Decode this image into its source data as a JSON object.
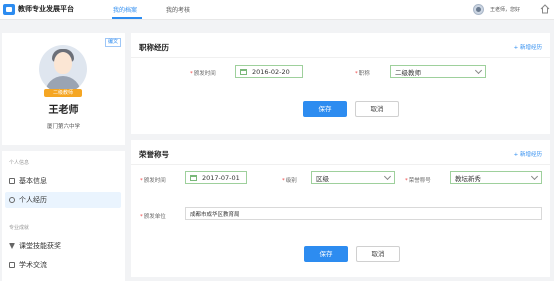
{
  "header": {
    "app_title": "教师专业发展平台",
    "tabs": [
      {
        "label": "我的档案",
        "active": true
      },
      {
        "label": "我的考核",
        "active": false
      }
    ],
    "user_greeting": "王老师，您好",
    "accent_color": "#2d8cf0"
  },
  "profile": {
    "edit_tag": "编文",
    "badge": "二级教师",
    "name": "王老师",
    "school": "厦门第六中学"
  },
  "menu": {
    "group_personal": "个人信息",
    "items_personal": [
      {
        "label": "基本信息",
        "icon": "document-icon",
        "active": false
      },
      {
        "label": "个人经历",
        "icon": "clock-icon",
        "active": true
      }
    ],
    "group_achievement": "专业成就",
    "items_achievement": [
      {
        "label": "课堂技能获奖",
        "icon": "trophy-icon",
        "active": false
      },
      {
        "label": "学术交流",
        "icon": "chat-icon",
        "active": false
      }
    ]
  },
  "title_card": {
    "title": "职称经历",
    "add_label": "+ 新增经历",
    "time_label": "颁发时间",
    "time_value": "2016-02-20",
    "title_label": "职称",
    "title_value": "二级教师",
    "save_label": "保存",
    "cancel_label": "取消"
  },
  "honor_card": {
    "title": "荣誉称号",
    "add_label": "+ 新增经历",
    "time_label": "颁发时间",
    "time_value": "2017-07-01",
    "level_label": "级别",
    "level_value": "区级",
    "honor_label": "荣誉称号",
    "honor_value": "教坛新秀",
    "issuer_label": "颁发单位",
    "issuer_value": "成都市成华区教育局",
    "save_label": "保存",
    "cancel_label": "取消"
  }
}
